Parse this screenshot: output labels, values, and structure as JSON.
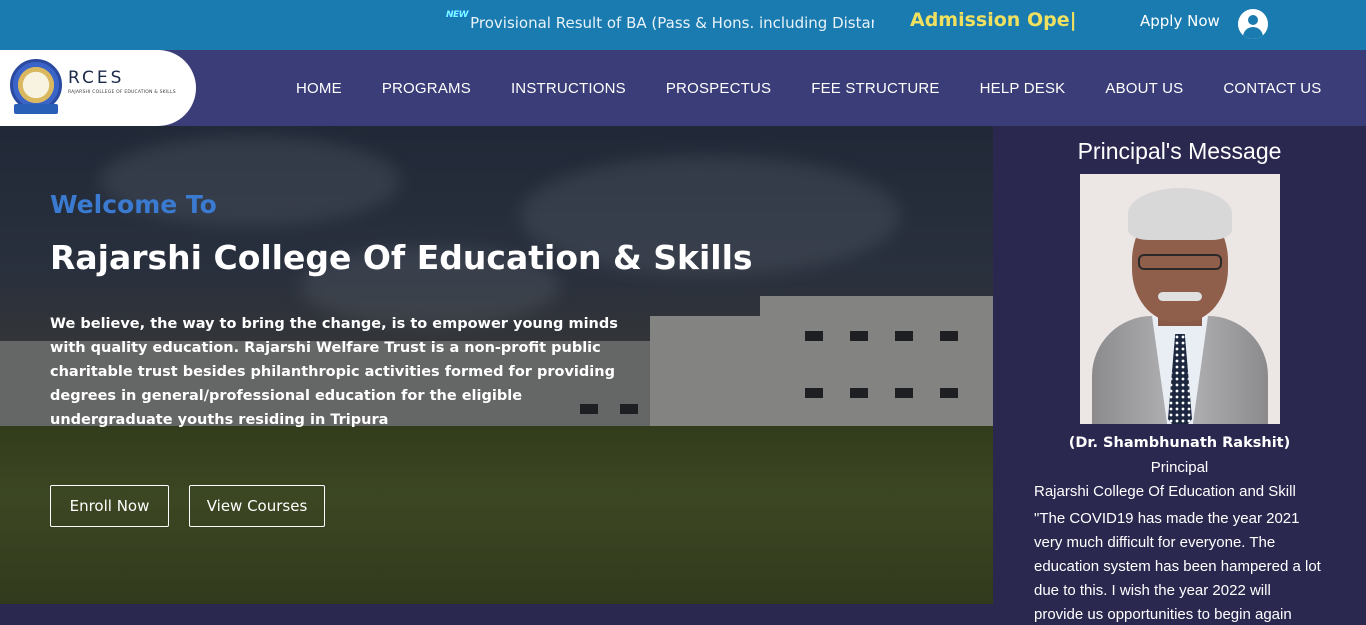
{
  "topbar": {
    "new_badge": "NEW",
    "ticker_text": "Provisional Result of BA (Pass & Hons. including Distanc",
    "admission_text": "Admission Ope|",
    "apply_label": "Apply Now",
    "user_icon": "user-circle-icon",
    "colors": {
      "bar": "#1a7bb0",
      "admission": "#f0e060"
    }
  },
  "logo": {
    "title": "RCES",
    "subtitle": "RAJARSHI COLLEGE OF EDUCATION & SKILLS",
    "seal_icon": "college-seal-icon"
  },
  "nav": {
    "items": [
      {
        "label": "HOME"
      },
      {
        "label": "PROGRAMS"
      },
      {
        "label": "INSTRUCTIONS"
      },
      {
        "label": "PROSPECTUS"
      },
      {
        "label": "FEE STRUCTURE"
      },
      {
        "label": "HELP DESK"
      },
      {
        "label": "ABOUT US"
      },
      {
        "label": "CONTACT US"
      }
    ],
    "color": "#3b3d78"
  },
  "hero": {
    "welcome": "Welcome To",
    "college_name": "Rajarshi College Of Education & Skills",
    "description": "We believe, the way to bring the change, is to empower young minds with quality education. Rajarshi Welfare Trust is a non-profit public charitable trust besides philanthropic activities formed for providing degrees in general/professional education for the eligible undergraduate youths residing in Tripura",
    "enroll_label": "Enroll Now",
    "courses_label": "View Courses",
    "welcome_color": "#3a7ad0"
  },
  "principal": {
    "heading": "Principal's Message",
    "name": "(Dr. Shambhunath Rakshit)",
    "role": "Principal",
    "college_line": "Rajarshi College Of Education and Skill",
    "message": "\"The COVID19 has made the year 2021 very much difficult for everyone. The education system has been hampered a lot due to this. I wish the year 2022 will provide us opportunities to begin again",
    "panel_color": "#2b2850"
  }
}
